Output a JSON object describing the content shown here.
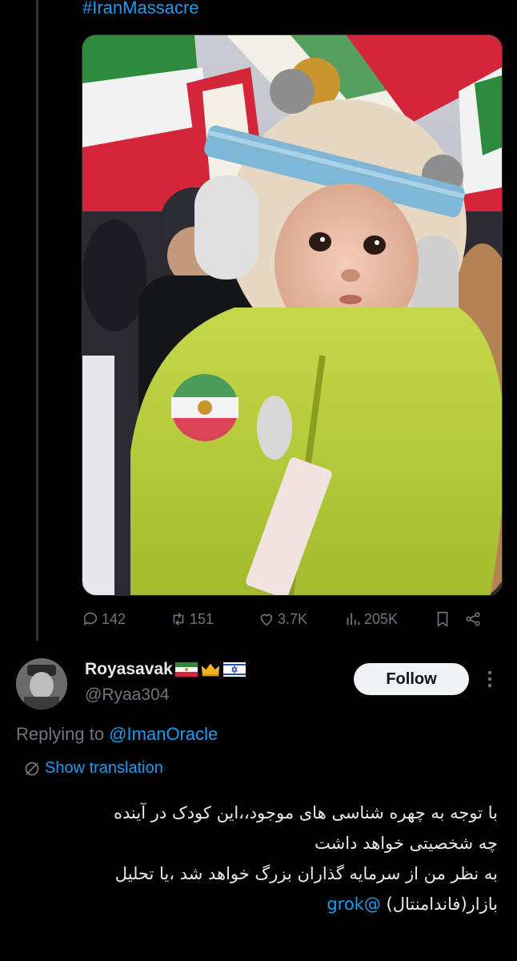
{
  "tweet": {
    "hashtag": "#IranMassacre",
    "media_description_icon": "photo",
    "stats": {
      "replies": "142",
      "reposts": "151",
      "likes": "3.7K",
      "views": "205K"
    }
  },
  "reply": {
    "display_name": "Royasavak",
    "handle": "@Ryaa304",
    "follow_label": "Follow",
    "replying_prefix": "Replying to",
    "replying_to": "@ImanOracle",
    "show_translation": "Show translation",
    "text_lines": [
      "با توجه به چهره شناسی های موجود،،این کودک در آینده",
      "چه شخصیتی خواهد داشت",
      "به نظر من از سرمایه گذاران بزرگ خواهد شد ،یا تحلیل",
      "بازار(فاندامنتال)"
    ],
    "mention": "@grok"
  },
  "colors": {
    "background": "#000000",
    "text": "#e7e9ea",
    "muted": "#71767b",
    "link": "#1d9bf0",
    "follow_bg": "#eff3f4"
  }
}
